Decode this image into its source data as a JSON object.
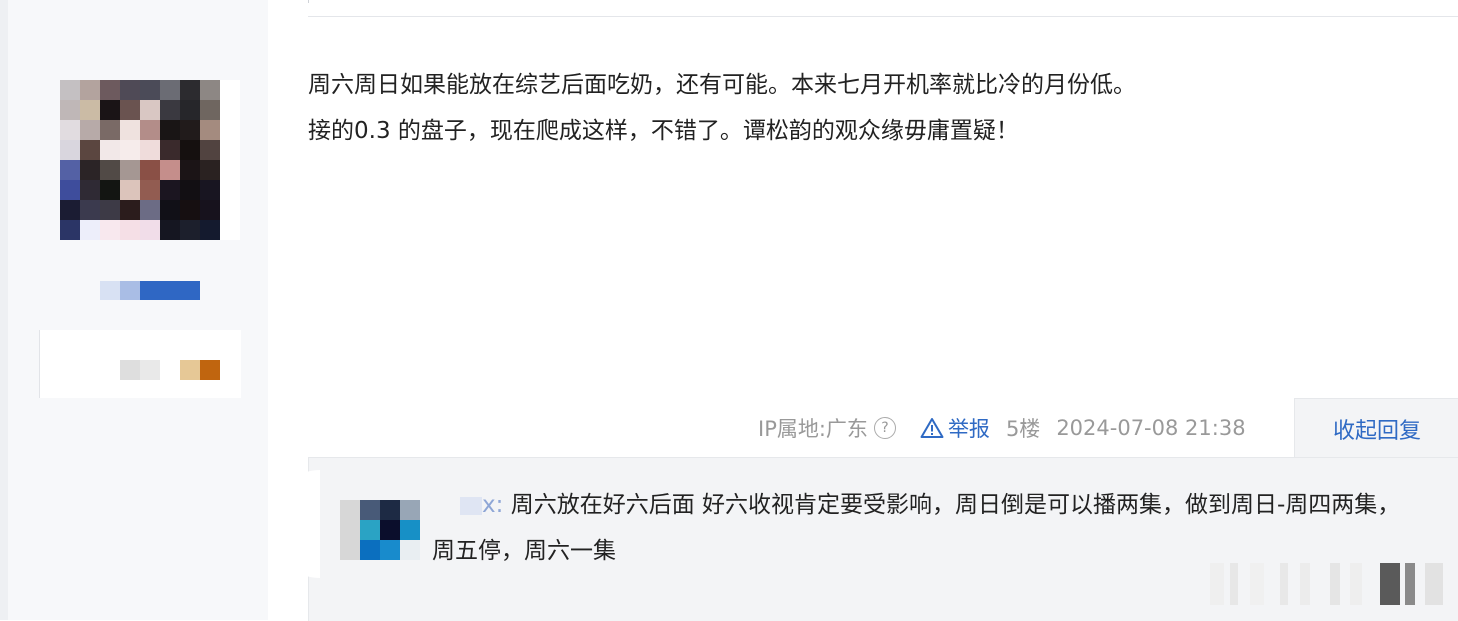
{
  "post": {
    "content_lines": [
      "周六周日如果能放在综艺后面吃奶，还有可能。本来七月开机率就比冷的月份低。",
      "接的0.3 的盘子，现在爬成这样，不错了。谭松韵的观众缘毋庸置疑！"
    ],
    "meta": {
      "ip_label": "IP属地:广东",
      "help_icon": "?",
      "report_label": "举报",
      "floor": "5楼",
      "timestamp": "2024-07-08 21:38"
    },
    "reply_toggle_label": "收起回复"
  },
  "reply": {
    "name_suffix": "x:",
    "text": "周六放在好六后面 好六收视肯定要受影响，周日倒是可以播两集，做到周日-周四两集，周五停，周六一集"
  },
  "colors": {
    "accent": "#2f6ac4",
    "meta_text": "#999999",
    "reply_background": "#f3f4f6"
  },
  "icons": [
    "question-circle-icon",
    "warning-triangle-icon"
  ]
}
